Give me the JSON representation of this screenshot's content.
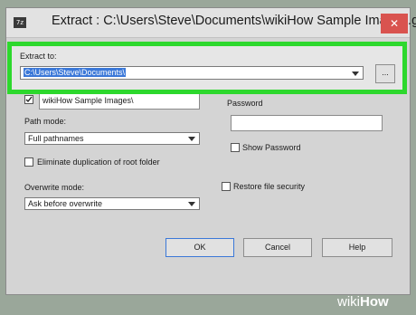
{
  "window": {
    "title": "Extract : C:\\Users\\Steve\\Documents\\wikiHow Sample Images.gz",
    "app_icon_text": "7z",
    "close_glyph": "✕"
  },
  "extract_to": {
    "label": "Extract to:",
    "value": "C:\\Users\\Steve\\Documents\\",
    "browse_label": "..."
  },
  "subfolder": {
    "checked": true,
    "value": "wikiHow Sample Images\\"
  },
  "path_mode": {
    "label": "Path mode:",
    "value": "Full pathnames"
  },
  "eliminate_duplication": {
    "label": "Eliminate duplication of root folder",
    "checked": false
  },
  "overwrite_mode": {
    "label": "Overwrite mode:",
    "value": "Ask before overwrite"
  },
  "password": {
    "label": "Password",
    "value": "",
    "show_label": "Show Password",
    "show_checked": false
  },
  "restore_security": {
    "label": "Restore file security",
    "checked": false
  },
  "buttons": {
    "ok": "OK",
    "cancel": "Cancel",
    "help": "Help"
  },
  "watermark": {
    "prefix": "wiki",
    "suffix": "How"
  },
  "colors": {
    "highlight": "#2dd82d",
    "selection": "#3b78d8",
    "close_button": "#d9534f"
  }
}
